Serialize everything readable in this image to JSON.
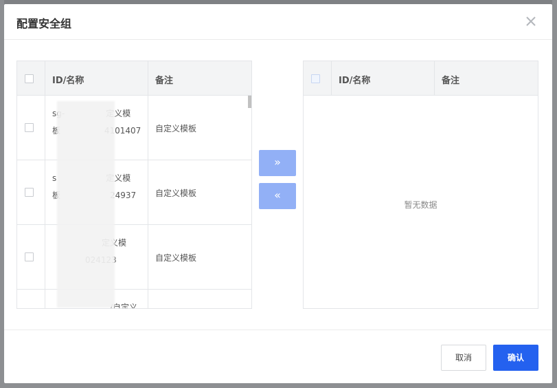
{
  "dialog": {
    "title": "配置安全组",
    "close_icon": "close-icon"
  },
  "left_panel": {
    "columns": [
      "ID/名称",
      "备注"
    ],
    "rows": [
      {
        "id_name": "sg-     定义模板      4101407",
        "remark": "自定义模板"
      },
      {
        "id_name": "s      定义模板      24937",
        "remark": "自定义模板"
      },
      {
        "id_name": "      定义模      024123",
        "remark": "自定义模板"
      },
      {
        "id_name": "       /自定义模",
        "remark": ""
      }
    ]
  },
  "right_panel": {
    "columns": [
      "ID/名称",
      "备注"
    ],
    "empty_text": "暂无数据"
  },
  "transfer": {
    "to_right_label": "»",
    "to_left_label": "«"
  },
  "footer": {
    "cancel_label": "取消",
    "confirm_label": "确认"
  },
  "colors": {
    "primary": "#2461ef",
    "primary_disabled": "#92b0f6"
  }
}
